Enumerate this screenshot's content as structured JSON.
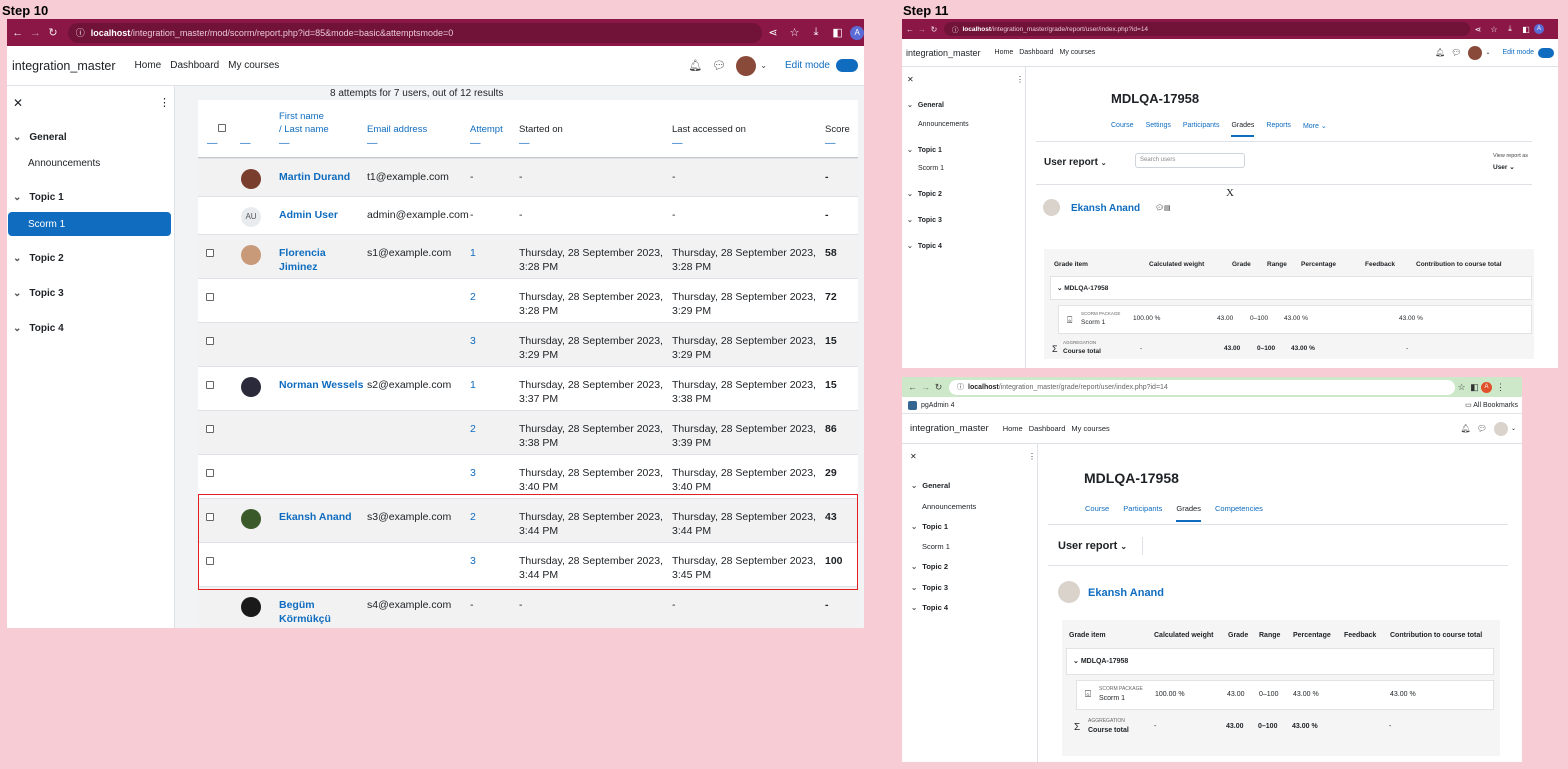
{
  "steps": {
    "left": "Step 10",
    "right": "Step 11"
  },
  "icons": {
    "back": "arrow-left-icon",
    "forward": "arrow-right-icon",
    "reload": "reload-icon",
    "info": "info-icon",
    "share": "share-icon",
    "star": "star-icon",
    "download": "download-icon",
    "sidebar": "sidebar-icon",
    "profile_initial": "A",
    "bell": "bell-icon",
    "chat": "chat-icon",
    "close": "close-icon",
    "kebab": "kebab-icon",
    "chevron": "chevron-down-icon",
    "help": "?",
    "sigma": "Σ"
  },
  "s10": {
    "url_host": "localhost",
    "url_path": "/integration_master/mod/scorm/report.php?id=85&mode=basic&attemptsmode=0",
    "site_name": "integration_master",
    "nav": [
      "Home",
      "Dashboard",
      "My courses"
    ],
    "edit_mode": "Edit mode",
    "drawer": {
      "general": "General",
      "announcements": "Announcements",
      "topic1": "Topic 1",
      "scorm1": "Scorm 1",
      "topic2": "Topic 2",
      "topic3": "Topic 3",
      "topic4": "Topic 4"
    },
    "summary": "8 attempts for 7 users, out of 12 results",
    "headers": {
      "first_name": "First name",
      "last_name": "/ Last name",
      "email": "Email address",
      "attempt": "Attempt",
      "started": "Started on",
      "last_accessed": "Last accessed on",
      "score": "Score",
      "dash": "—"
    },
    "rows": [
      {
        "name": "Martin Durand",
        "email": "t1@example.com",
        "attempt": "-",
        "started": "-",
        "accessed": "-",
        "score": "-"
      },
      {
        "name": "Admin User",
        "email": "admin@example.com",
        "attempt": "-",
        "started": "-",
        "accessed": "-",
        "score": "-",
        "initials": "AU"
      },
      {
        "name": "Florencia\nJiminez",
        "email": "s1@example.com",
        "attempt": "1",
        "started": "Thursday, 28 September 2023,\n3:28 PM",
        "accessed": "Thursday, 28 September 2023,\n3:28 PM",
        "score": "58"
      },
      {
        "name": "",
        "email": "",
        "attempt": "2",
        "started": "Thursday, 28 September 2023,\n3:28 PM",
        "accessed": "Thursday, 28 September 2023,\n3:29 PM",
        "score": "72"
      },
      {
        "name": "",
        "email": "",
        "attempt": "3",
        "started": "Thursday, 28 September 2023,\n3:29 PM",
        "accessed": "Thursday, 28 September 2023,\n3:29 PM",
        "score": "15"
      },
      {
        "name": "Norman Wessels",
        "email": "s2@example.com",
        "attempt": "1",
        "started": "Thursday, 28 September 2023,\n3:37 PM",
        "accessed": "Thursday, 28 September 2023,\n3:38 PM",
        "score": "15"
      },
      {
        "name": "",
        "email": "",
        "attempt": "2",
        "started": "Thursday, 28 September 2023,\n3:38 PM",
        "accessed": "Thursday, 28 September 2023,\n3:39 PM",
        "score": "86"
      },
      {
        "name": "",
        "email": "",
        "attempt": "3",
        "started": "Thursday, 28 September 2023,\n3:40 PM",
        "accessed": "Thursday, 28 September 2023,\n3:40 PM",
        "score": "29"
      },
      {
        "name": "Ekansh Anand",
        "email": "s3@example.com",
        "attempt": "2",
        "started": "Thursday, 28 September 2023,\n3:44 PM",
        "accessed": "Thursday, 28 September 2023,\n3:44 PM",
        "score": "43"
      },
      {
        "name": "",
        "email": "",
        "attempt": "3",
        "started": "Thursday, 28 September 2023,\n3:44 PM",
        "accessed": "Thursday, 28 September 2023,\n3:45 PM",
        "score": "100"
      },
      {
        "name": "Begüm\nKörmükçü",
        "email": "s4@example.com",
        "attempt": "-",
        "started": "-",
        "accessed": "-",
        "score": "-"
      }
    ]
  },
  "s11a": {
    "url_host": "localhost",
    "url_path": "/integration_master/grade/report/user/index.php?id=14",
    "site_name": "integration_master",
    "nav": [
      "Home",
      "Dashboard",
      "My courses"
    ],
    "edit_mode": "Edit mode",
    "drawer": {
      "general": "General",
      "announcements": "Announcements",
      "topic1": "Topic 1",
      "scorm1": "Scorm 1",
      "topic2": "Topic 2",
      "topic3": "Topic 3",
      "topic4": "Topic 4"
    },
    "course_title": "MDLQA-17958",
    "tabs": [
      "Course",
      "Settings",
      "Participants",
      "Grades",
      "Reports",
      "More ⌄"
    ],
    "report_select": "User report",
    "search_placeholder": "Search users",
    "view_as_label": "View report as",
    "view_as_value": "User",
    "x_mark": "X",
    "user_name": "Ekansh Anand",
    "grade_headers": [
      "Grade item",
      "Calculated weight",
      "Grade",
      "Range",
      "Percentage",
      "Feedback",
      "Contribution to course total"
    ],
    "category": "MDLQA-17958",
    "item_type": "SCORM PACKAGE",
    "item_name": "Scorm 1",
    "item_weight": "100.00 %",
    "item_grade": "43.00",
    "item_range": "0–100",
    "item_pct": "43.00 %",
    "item_contrib": "43.00 %",
    "agg_type": "AGGREGATION",
    "total_name": "Course total",
    "total_weight": "-",
    "total_grade": "43.00",
    "total_range": "0–100",
    "total_pct": "43.00 %",
    "total_contrib": "-"
  },
  "s11b": {
    "url_host": "localhost",
    "url_path": "/integration_master/grade/report/user/index.php?id=14",
    "bookmark": "pgAdmin 4",
    "all_bookmarks": "All Bookmarks",
    "site_name": "integration_master",
    "nav": [
      "Home",
      "Dashboard",
      "My courses"
    ],
    "drawer": {
      "general": "General",
      "announcements": "Announcements",
      "topic1": "Topic 1",
      "scorm1": "Scorm 1",
      "topic2": "Topic 2",
      "topic3": "Topic 3",
      "topic4": "Topic 4"
    },
    "course_title": "MDLQA-17958",
    "tabs": [
      "Course",
      "Participants",
      "Grades",
      "Competencies"
    ],
    "report_select": "User report",
    "user_name": "Ekansh Anand",
    "grade_headers": [
      "Grade item",
      "Calculated weight",
      "Grade",
      "Range",
      "Percentage",
      "Feedback",
      "Contribution to course total"
    ],
    "category": "MDLQA-17958",
    "item_type": "SCORM PACKAGE",
    "item_name": "Scorm 1",
    "item_weight": "100.00 %",
    "item_grade": "43.00",
    "item_range": "0–100",
    "item_pct": "43.00 %",
    "item_contrib": "43.00 %",
    "agg_type": "AGGREGATION",
    "total_name": "Course total",
    "total_weight": "-",
    "total_grade": "43.00",
    "total_range": "0–100",
    "total_pct": "43.00 %",
    "total_contrib": "-"
  }
}
